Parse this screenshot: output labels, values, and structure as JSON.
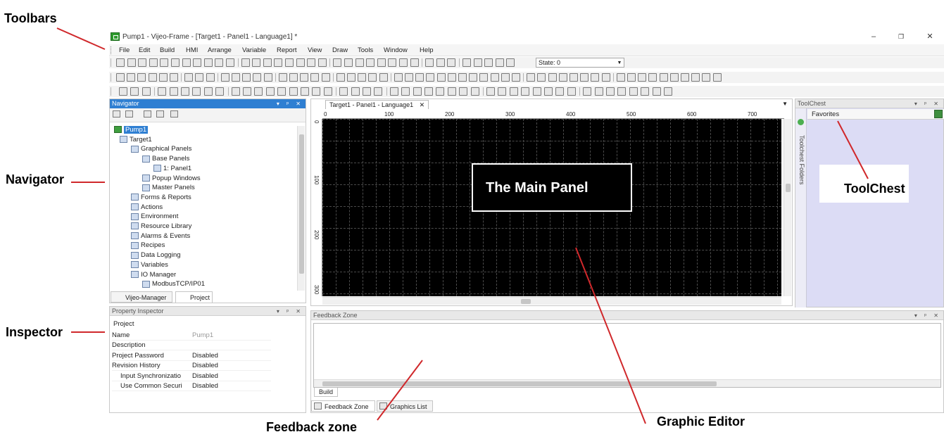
{
  "annotations": {
    "toolbars": "Toolbars",
    "navigator": "Navigator",
    "inspector": "Inspector",
    "feedback_zone": "Feedback zone",
    "graphic_editor": "Graphic Editor",
    "toolchest": "ToolChest"
  },
  "window": {
    "title": "Pump1 - Vijeo-Frame - [Target1 - Panel1 - Language1] *",
    "minimize": "–",
    "restore": "❐",
    "close": "✕"
  },
  "menubar": [
    "File",
    "Edit",
    "Build",
    "HMI",
    "Arrange",
    "Variable",
    "Report",
    "View",
    "Draw",
    "Tools",
    "Window",
    "Help"
  ],
  "toolbar": {
    "state_label": "State: 0"
  },
  "navigator": {
    "title": "Navigator",
    "tree": [
      {
        "label": "Pump1",
        "selected": true
      },
      {
        "label": "Target1"
      },
      {
        "label": "Graphical Panels"
      },
      {
        "label": "Base Panels"
      },
      {
        "label": "1: Panel1"
      },
      {
        "label": "Popup Windows"
      },
      {
        "label": "Master Panels"
      },
      {
        "label": "Forms & Reports"
      },
      {
        "label": "Actions"
      },
      {
        "label": "Environment"
      },
      {
        "label": "Resource Library"
      },
      {
        "label": "Alarms & Events"
      },
      {
        "label": "Recipes"
      },
      {
        "label": "Data Logging"
      },
      {
        "label": "Variables"
      },
      {
        "label": "IO Manager"
      },
      {
        "label": "ModbusTCP/IP01"
      }
    ],
    "tabs": [
      "Vijeo-Manager",
      "Project"
    ]
  },
  "inspector": {
    "title": "Property Inspector",
    "section": "Project",
    "rows": [
      {
        "key": "Name",
        "value": "Pump1"
      },
      {
        "key": "Description",
        "value": ""
      },
      {
        "key": "Project Password",
        "value": "Disabled"
      },
      {
        "key": "Revision History",
        "value": "Disabled"
      },
      {
        "key": "Input Synchronizatio",
        "value": "Disabled"
      },
      {
        "key": "Use Common Securi",
        "value": "Disabled"
      }
    ]
  },
  "editor": {
    "tab": "Target1 - Panel1 - Language1",
    "ruler_top": [
      "0",
      "100",
      "200",
      "300",
      "400",
      "500",
      "600",
      "700"
    ],
    "ruler_left": [
      "0",
      "100",
      "200",
      "300"
    ],
    "panel_label": "The Main Panel"
  },
  "toolchest": {
    "title": "ToolChest",
    "side_label": "Toolchest Folders",
    "favorites": "Favorites"
  },
  "feedback": {
    "title": "Feedback Zone",
    "inner_tab": "Build",
    "bottom_tabs": [
      "Feedback Zone",
      "Graphics List"
    ]
  }
}
